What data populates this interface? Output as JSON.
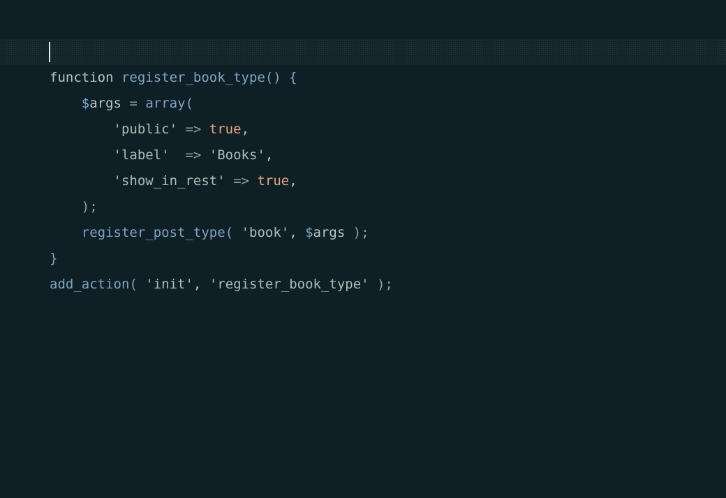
{
  "editor": {
    "lines": [
      [],
      [
        {
          "t": "function ",
          "k": "kw"
        },
        {
          "t": "register_book_type",
          "k": "fn"
        },
        {
          "t": "() {",
          "k": "fn"
        }
      ],
      [
        {
          "t": "    ",
          "k": "plain"
        },
        {
          "t": "$",
          "k": "var"
        },
        {
          "t": "args",
          "k": "plain"
        },
        {
          "t": " = ",
          "k": "op"
        },
        {
          "t": "array(",
          "k": "fn"
        }
      ],
      [
        {
          "t": "        ",
          "k": "plain"
        },
        {
          "t": "'public'",
          "k": "str"
        },
        {
          "t": " => ",
          "k": "op"
        },
        {
          "t": "true",
          "k": "bool"
        },
        {
          "t": ",",
          "k": "punc"
        }
      ],
      [
        {
          "t": "        ",
          "k": "plain"
        },
        {
          "t": "'label'",
          "k": "str"
        },
        {
          "t": "  => ",
          "k": "op"
        },
        {
          "t": "'Books'",
          "k": "str"
        },
        {
          "t": ",",
          "k": "punc"
        }
      ],
      [
        {
          "t": "        ",
          "k": "plain"
        },
        {
          "t": "'show_in_rest'",
          "k": "str"
        },
        {
          "t": " => ",
          "k": "op"
        },
        {
          "t": "true",
          "k": "bool"
        },
        {
          "t": ",",
          "k": "punc"
        }
      ],
      [
        {
          "t": "    ",
          "k": "plain"
        },
        {
          "t": ");",
          "k": "op"
        }
      ],
      [
        {
          "t": "    ",
          "k": "plain"
        },
        {
          "t": "register_post_type",
          "k": "fn"
        },
        {
          "t": "( ",
          "k": "fn"
        },
        {
          "t": "'book'",
          "k": "str"
        },
        {
          "t": ", ",
          "k": "punc"
        },
        {
          "t": "$",
          "k": "var"
        },
        {
          "t": "args",
          "k": "plain"
        },
        {
          "t": " );",
          "k": "op"
        }
      ],
      [
        {
          "t": "}",
          "k": "fn"
        }
      ],
      [
        {
          "t": "add_action",
          "k": "fn"
        },
        {
          "t": "( ",
          "k": "fn"
        },
        {
          "t": "'init'",
          "k": "str"
        },
        {
          "t": ", ",
          "k": "punc"
        },
        {
          "t": "'register_book_type'",
          "k": "str"
        },
        {
          "t": " );",
          "k": "op"
        }
      ]
    ]
  }
}
